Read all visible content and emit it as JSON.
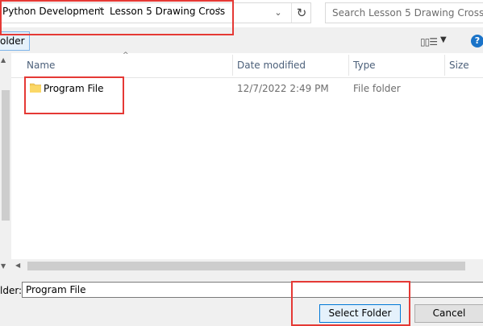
{
  "address_bar": {
    "crumbs": [
      "Python Development",
      "Lesson 5 Drawing Cross"
    ],
    "separator": "›"
  },
  "search": {
    "placeholder": "Search Lesson 5 Drawing Cross"
  },
  "toolbar": {
    "new_folder_label": "older"
  },
  "columns": {
    "name": "Name",
    "date_modified": "Date modified",
    "type": "Type",
    "size": "Size"
  },
  "files": [
    {
      "name": "Program File",
      "date_modified": "12/7/2022 2:49 PM",
      "type": "File folder",
      "size": ""
    }
  ],
  "footer": {
    "folder_label": "lder:",
    "folder_value": "Program File",
    "select_button": "Select Folder",
    "cancel_button": "Cancel"
  },
  "icons": {
    "help": "?",
    "refresh": "↻",
    "dropdown": "⌄"
  },
  "colors": {
    "annotation": "#e53935",
    "accent": "#0078d7",
    "folder": "#f6cc5a"
  }
}
